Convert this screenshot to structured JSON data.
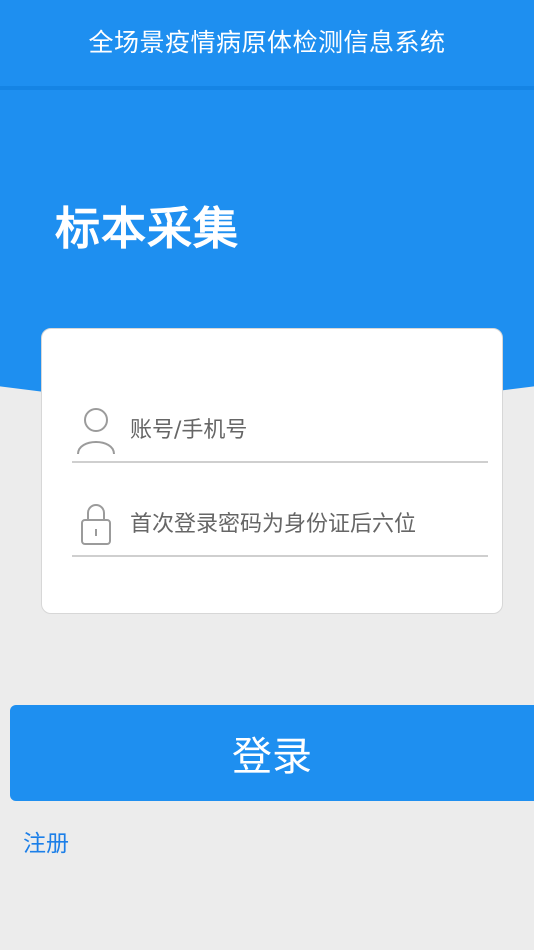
{
  "header": {
    "title": "全场景疫情病原体检测信息系统"
  },
  "page": {
    "title": "标本采集"
  },
  "form": {
    "account_placeholder": "账号/手机号",
    "password_placeholder": "首次登录密码为身份证后六位",
    "account_icon": "user-icon",
    "password_icon": "lock-icon"
  },
  "actions": {
    "login_label": "登录",
    "register_label": "注册"
  },
  "colors": {
    "accent": "#1e8ff0",
    "background": "#ececec",
    "link": "#1c7fe8"
  }
}
